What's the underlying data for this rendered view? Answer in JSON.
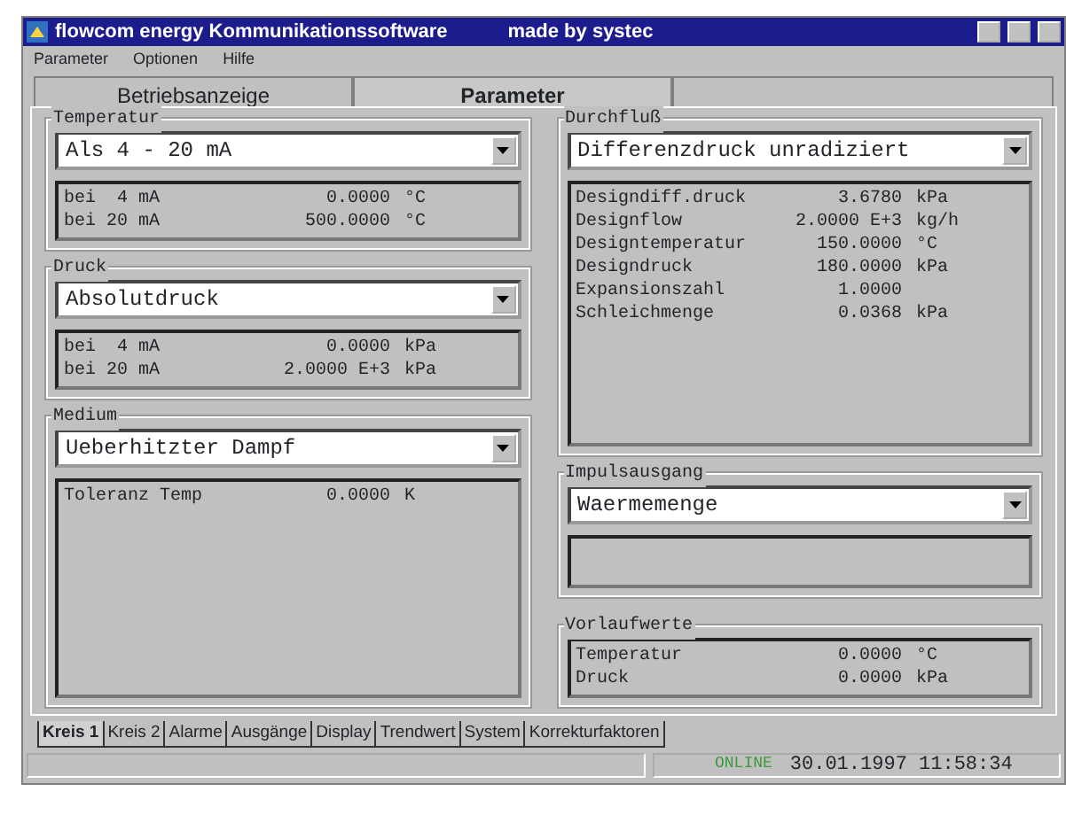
{
  "window": {
    "title": "flowcom energy Kommunikationssoftware",
    "subtitle": "made by systec"
  },
  "menu": [
    "Parameter",
    "Optionen",
    "Hilfe"
  ],
  "top_tabs": [
    {
      "label": "Betriebsanzeige",
      "selected": false
    },
    {
      "label": "Parameter",
      "selected": true
    }
  ],
  "left_groups": [
    {
      "title": "Temperatur",
      "dropdown": "Als 4 - 20 mA",
      "rows": [
        {
          "label": "bei  4 mA",
          "value": "0.0000",
          "unit": "°C"
        },
        {
          "label": "bei 20 mA",
          "value": "500.0000",
          "unit": "°C"
        }
      ]
    },
    {
      "title": "Druck",
      "dropdown": "Absolutdruck",
      "rows": [
        {
          "label": "bei  4 mA",
          "value": "0.0000",
          "unit": "kPa"
        },
        {
          "label": "bei 20 mA",
          "value": "2.0000 E+3",
          "unit": "kPa"
        }
      ]
    },
    {
      "title": "Medium",
      "dropdown": "Ueberhitzter Dampf",
      "rows": [
        {
          "label": "Toleranz Temp",
          "value": "0.0000",
          "unit": "K"
        }
      ]
    }
  ],
  "right_groups": [
    {
      "title": "Durchfluß",
      "dropdown": "Differenzdruck unradiziert",
      "rows": [
        {
          "label": "Designdiff.druck",
          "value": "3.6780",
          "unit": "kPa"
        },
        {
          "label": "Designflow",
          "value": "2.0000 E+3",
          "unit": "kg/h"
        },
        {
          "label": "Designtemperatur",
          "value": "150.0000",
          "unit": "°C"
        },
        {
          "label": "Designdruck",
          "value": "180.0000",
          "unit": "kPa"
        },
        {
          "label": "Expansionszahl",
          "value": "1.0000"
        },
        {
          "label": "Schleichmenge",
          "value": "0.0368",
          "unit": "kPa"
        }
      ]
    },
    {
      "title": "Impulsausgang",
      "dropdown": "Waermemenge"
    },
    {
      "title": "Vorlaufwerte",
      "rows": [
        {
          "label": "Temperatur",
          "value": "0.0000",
          "unit": "°C"
        },
        {
          "label": "Druck",
          "value": "0.0000",
          "unit": "kPa"
        }
      ]
    }
  ],
  "bottom_tabs": [
    {
      "label": "Kreis 1",
      "selected": true
    },
    {
      "label": "Kreis 2",
      "selected": false
    },
    {
      "label": "Alarme",
      "selected": false
    },
    {
      "label": "Ausgänge",
      "selected": false
    },
    {
      "label": "Display",
      "selected": false
    },
    {
      "label": "Trendwert",
      "selected": false
    },
    {
      "label": "System",
      "selected": false
    },
    {
      "label": "Korrekturfaktoren",
      "selected": false
    }
  ],
  "status_bar": {
    "connection": "ONLINE",
    "datetime": "30.01.1997 11:58:34"
  }
}
